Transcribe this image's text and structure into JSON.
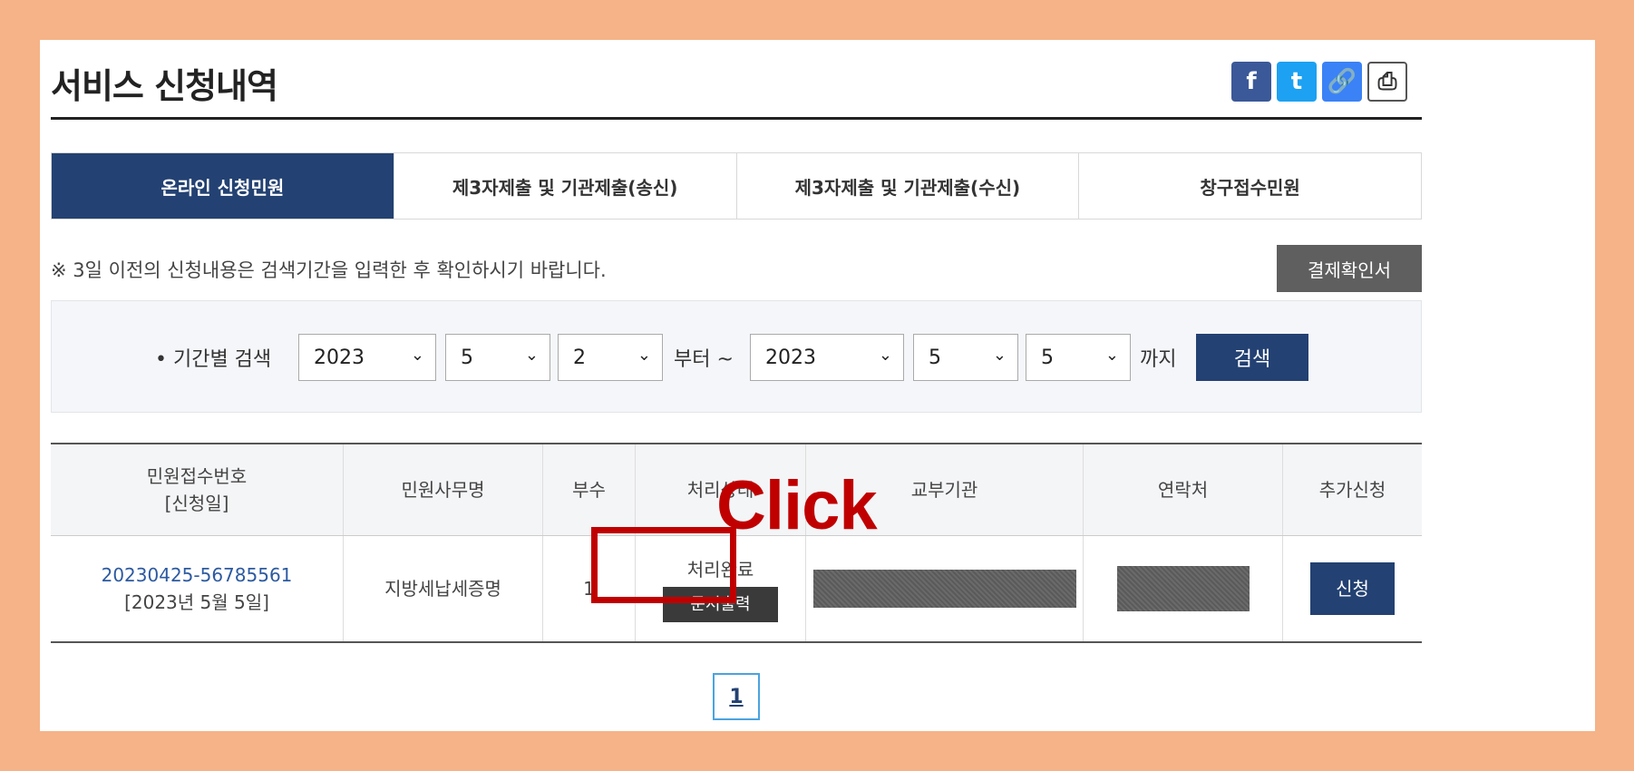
{
  "header": {
    "title": "서비스 신청내역"
  },
  "share": {
    "facebook": "f",
    "twitter": "t",
    "link": "🔗",
    "print": "⎙"
  },
  "tabs": [
    {
      "label": "온라인 신청민원"
    },
    {
      "label": "제3자제출 및 기관제출(송신)"
    },
    {
      "label": "제3자제출 및 기관제출(수신)"
    },
    {
      "label": "창구접수민원"
    }
  ],
  "notice": "※ 3일 이전의 신청내용은 검색기간을 입력한 후 확인하시기 바랍니다.",
  "pay_button": "결제확인서",
  "search": {
    "label": "• 기간별 검색",
    "from_year": "2023",
    "from_month": "5",
    "from_day": "2",
    "from_text": "부터 ~",
    "to_year": "2023",
    "to_month": "5",
    "to_day": "5",
    "to_text": "까지",
    "button": "검색"
  },
  "table": {
    "headers": [
      "민원접수번호",
      "[신청일]",
      "민원사무명",
      "부수",
      "처리상태",
      "교부기관",
      "연락처",
      "추가신청"
    ],
    "row": {
      "receipt_no": "20230425-56785561",
      "date": "[2023년 5월 5일]",
      "service": "지방세납세증명",
      "copies": "1",
      "status": "처리완료",
      "print_button": "문서출력",
      "apply_button": "신청"
    }
  },
  "annotation": {
    "click": "Click"
  },
  "pagination": {
    "current": "1"
  }
}
